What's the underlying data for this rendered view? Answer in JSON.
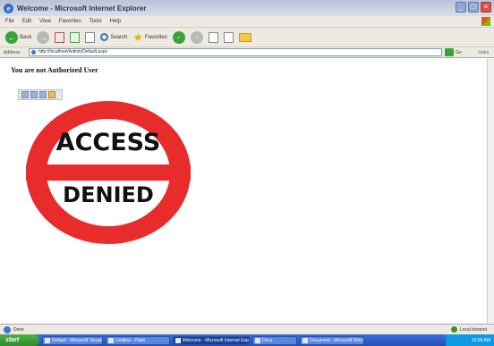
{
  "window": {
    "title": "Welcome - Microsoft Internet Explorer",
    "min": "_",
    "max": "□",
    "close": "×"
  },
  "menu": [
    "File",
    "Edit",
    "View",
    "Favorites",
    "Tools",
    "Help"
  ],
  "toolbar": {
    "back_label": "Back",
    "search_label": "Search",
    "favorites_label": "Favorites"
  },
  "address": {
    "label": "Address",
    "url": "http://localhost/Admin/Default.aspx",
    "go_label": "Go",
    "links_label": "Links"
  },
  "page": {
    "message": "You are not Authorized User",
    "sign_top": "ACCESS",
    "sign_bottom": "DENIED"
  },
  "status": {
    "left": "Done",
    "right": "Local intranet"
  },
  "taskbar": {
    "start": "start",
    "tasks": [
      "Default - Microsoft Visual Studio",
      "Untitled - Paint",
      "Welcome - Microsoft Internet Explorer",
      "Docs",
      "Document - Microsoft Word"
    ],
    "clock": "10:06 AM"
  }
}
